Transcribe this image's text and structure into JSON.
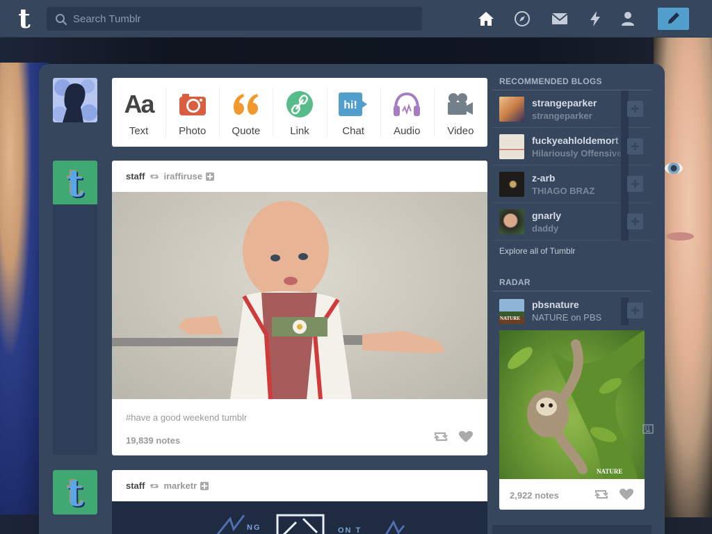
{
  "header": {
    "search_placeholder": "Search Tumblr",
    "nav_icons": [
      "home-icon",
      "explore-icon",
      "inbox-icon",
      "activity-icon",
      "account-icon"
    ],
    "compose_icon": "pencil-icon",
    "accent": "#529ecc",
    "bar_color": "#36465d"
  },
  "post_types": [
    {
      "label": "Text",
      "icon": "Aa"
    },
    {
      "label": "Photo",
      "icon": "camera-icon"
    },
    {
      "label": "Quote",
      "icon": "quote-icon"
    },
    {
      "label": "Link",
      "icon": "link-icon"
    },
    {
      "label": "Chat",
      "icon": "hi!"
    },
    {
      "label": "Audio",
      "icon": "headphones-icon"
    },
    {
      "label": "Video",
      "icon": "video-camera-icon"
    }
  ],
  "posts": [
    {
      "blog": "staff",
      "source": "iraffiruse",
      "tags": "#have a good weekend tumblr",
      "notes": "19,839 notes"
    },
    {
      "blog": "staff",
      "source": "marketr",
      "banner_text": [
        "NG",
        "ON T"
      ]
    }
  ],
  "sidebar": {
    "recommended_title": "RECOMMENDED BLOGS",
    "recommended": [
      {
        "name": "strangeparker",
        "sub": "strangeparker"
      },
      {
        "name": "fuckyeahloldemort",
        "sub": "Hilariously Offensive"
      },
      {
        "name": "z-arb",
        "sub": "THIAGO BRAZ"
      },
      {
        "name": "gnarly",
        "sub": "daddy"
      }
    ],
    "explore": "Explore all of Tumblr",
    "radar_title": "RADAR",
    "radar": {
      "name": "pbsnature",
      "sub": "NATURE on PBS",
      "avatar_text": "NATURE",
      "image_caption": "NATURE",
      "notes": "2,922 notes"
    }
  }
}
